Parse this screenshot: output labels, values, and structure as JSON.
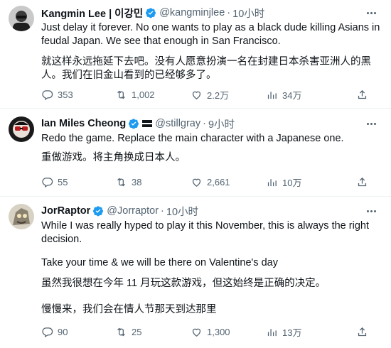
{
  "tweets": [
    {
      "name": "Kangmin Lee | 이강민",
      "handle": "@kangminjlee",
      "dot": "·",
      "time": "10小时",
      "paragraphs": [
        "Just delay it forever. No one wants to play as a black dude killing Asians in feudal Japan. We see that enough in San Francisco.",
        "就这样永远拖延下去吧。没有人愿意扮演一名在封建日本杀害亚洲人的黑人。我们在旧金山看到的已经够多了。"
      ],
      "replies": "353",
      "reposts": "1,002",
      "likes": "2.2万",
      "views": "34万"
    },
    {
      "name": "Ian Miles Cheong",
      "handle": "@stillgray",
      "dot": "·",
      "time": "9小时",
      "paragraphs": [
        "Redo the game. Replace the main character with a Japanese one.",
        "重做游戏。将主角换成日本人。"
      ],
      "replies": "55",
      "reposts": "38",
      "likes": "2,661",
      "views": "10万"
    },
    {
      "name": "JorRaptor",
      "handle": "@Jorraptor",
      "dot": "·",
      "time": "10小时",
      "paragraphs": [
        "While I was really hyped to play it this November, this is always the right decision.",
        "Take your time & we will be there on Valentine's day",
        "虽然我很想在今年 11 月玩这款游戏，但这始终是正确的决定。",
        "慢慢来，我们会在情人节那天到达那里"
      ],
      "replies": "90",
      "reposts": "25",
      "likes": "1,300",
      "views": "13万"
    }
  ],
  "colors": {
    "verified": "#1d9bf0",
    "secondary_text": "#536471",
    "divider": "#eff3f4"
  },
  "icons": [
    "reply-icon",
    "repost-icon",
    "like-icon",
    "views-icon",
    "share-icon",
    "more-icon",
    "verified-badge-icon"
  ]
}
